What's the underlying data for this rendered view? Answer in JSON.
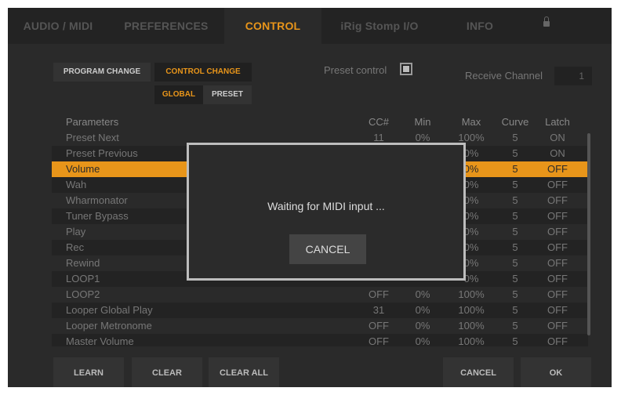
{
  "tabs": [
    {
      "label": "AUDIO / MIDI"
    },
    {
      "label": "PREFERENCES"
    },
    {
      "label": "CONTROL"
    },
    {
      "label": "iRig Stomp I/O"
    },
    {
      "label": "INFO"
    }
  ],
  "controls": {
    "program_change": "PROGRAM CHANGE",
    "control_change": "CONTROL CHANGE",
    "global": "GLOBAL",
    "preset": "PRESET",
    "preset_control_label": "Preset control",
    "receive_channel_label": "Receive Channel",
    "receive_channel_value": "1"
  },
  "table": {
    "headers": {
      "name": "Parameters",
      "cc": "CC#",
      "min": "Min",
      "max": "Max",
      "curve": "Curve",
      "latch": "Latch"
    },
    "rows": [
      {
        "name": "Preset Next",
        "cc": "11",
        "min": "0%",
        "max": "100%",
        "curve": "5",
        "latch": "ON"
      },
      {
        "name": "Preset Previous",
        "cc": "",
        "min": "",
        "max": "0%",
        "curve": "5",
        "latch": "ON"
      },
      {
        "name": "Volume",
        "cc": "",
        "min": "",
        "max": "0%",
        "curve": "5",
        "latch": "OFF"
      },
      {
        "name": "Wah",
        "cc": "",
        "min": "",
        "max": "0%",
        "curve": "5",
        "latch": "OFF"
      },
      {
        "name": "Wharmonator",
        "cc": "",
        "min": "",
        "max": "0%",
        "curve": "5",
        "latch": "OFF"
      },
      {
        "name": "Tuner Bypass",
        "cc": "",
        "min": "",
        "max": "0%",
        "curve": "5",
        "latch": "OFF"
      },
      {
        "name": "Play",
        "cc": "",
        "min": "",
        "max": "0%",
        "curve": "5",
        "latch": "OFF"
      },
      {
        "name": "Rec",
        "cc": "",
        "min": "",
        "max": "0%",
        "curve": "5",
        "latch": "OFF"
      },
      {
        "name": "Rewind",
        "cc": "",
        "min": "",
        "max": "0%",
        "curve": "5",
        "latch": "OFF"
      },
      {
        "name": "LOOP1",
        "cc": "",
        "min": "",
        "max": "0%",
        "curve": "5",
        "latch": "OFF"
      },
      {
        "name": "LOOP2",
        "cc": "OFF",
        "min": "0%",
        "max": "100%",
        "curve": "5",
        "latch": "OFF"
      },
      {
        "name": "Looper Global Play",
        "cc": "31",
        "min": "0%",
        "max": "100%",
        "curve": "5",
        "latch": "OFF"
      },
      {
        "name": "Looper Metronome",
        "cc": "OFF",
        "min": "0%",
        "max": "100%",
        "curve": "5",
        "latch": "OFF"
      },
      {
        "name": "Master Volume",
        "cc": "OFF",
        "min": "0%",
        "max": "100%",
        "curve": "5",
        "latch": "OFF"
      }
    ]
  },
  "modal": {
    "message": "Waiting for MIDI input ...",
    "cancel_label": "CANCEL"
  },
  "bottom": {
    "learn": "LEARN",
    "clear": "CLEAR",
    "clear_all": "CLEAR ALL",
    "cancel": "CANCEL",
    "ok": "OK"
  },
  "colors": {
    "accent": "#e8951a",
    "background": "#2a2a2a"
  },
  "icons": {
    "lock": "lock-icon"
  }
}
